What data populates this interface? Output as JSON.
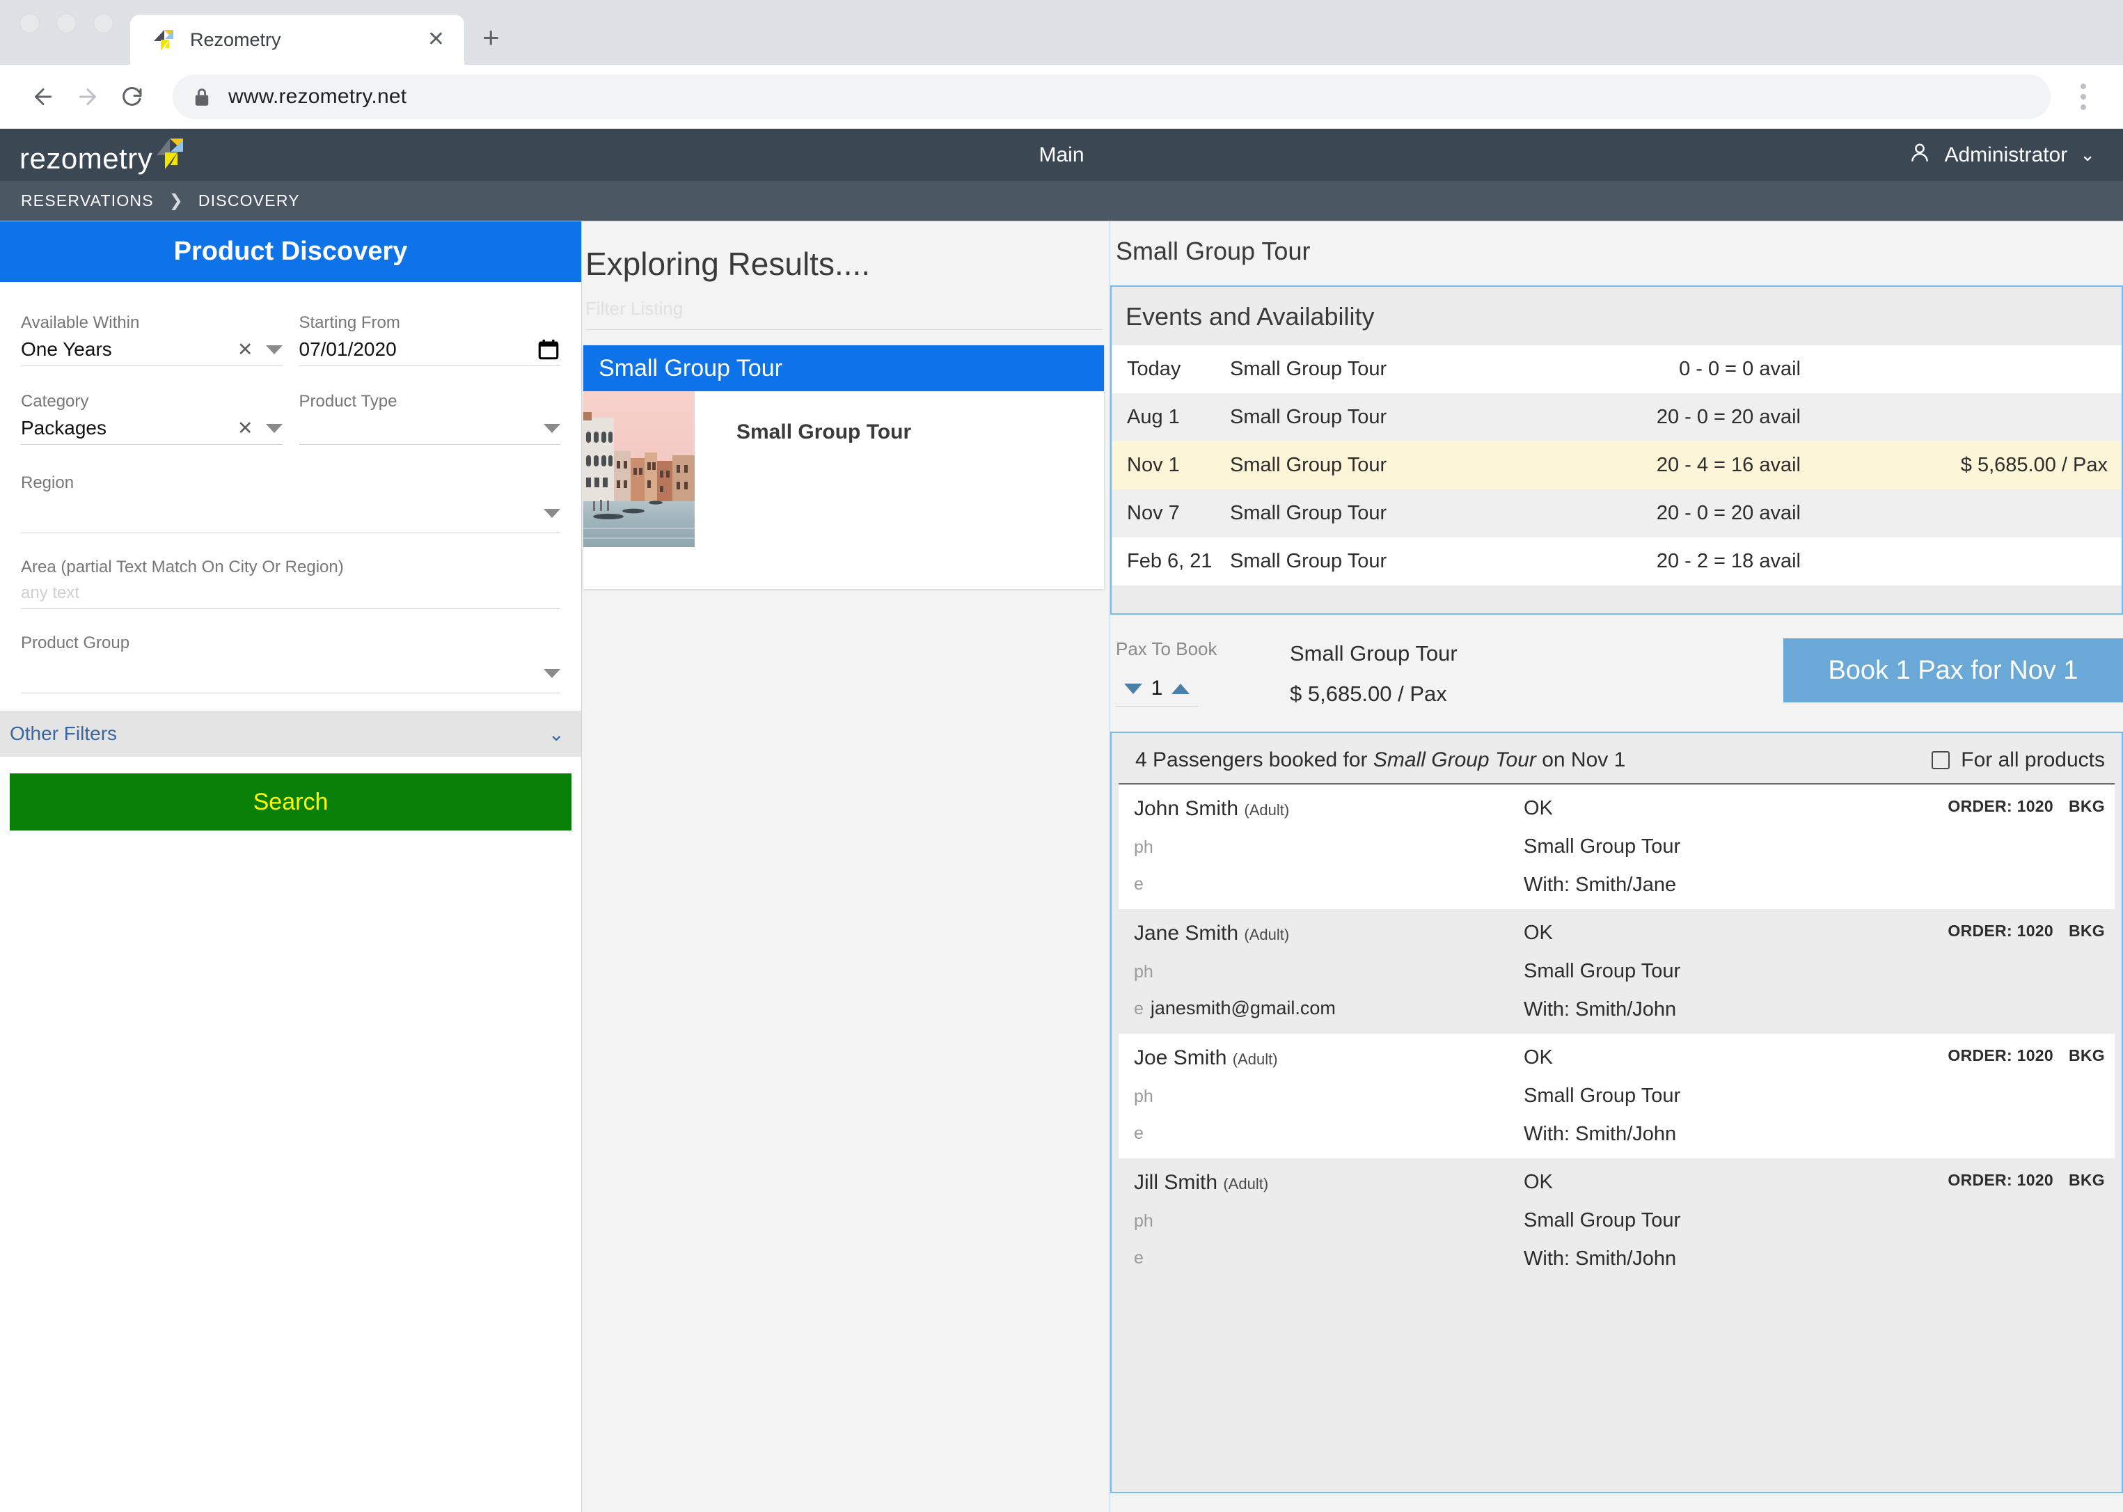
{
  "browser": {
    "tab_title": "Rezometry",
    "tab_close": "✕",
    "new_tab": "+",
    "url": "www.rezometry.net",
    "icons": {
      "back": "back-arrow-icon",
      "forward": "forward-arrow-icon",
      "reload": "reload-icon",
      "lock": "lock-icon",
      "menu": "kebab-menu-icon",
      "favicon": "rezometry-favicon"
    }
  },
  "appbar": {
    "brand": "rezometry",
    "main_label": "Main",
    "user": "Administrator",
    "chevron": "⌄"
  },
  "breadcrumb": {
    "items": [
      "RESERVATIONS",
      "DISCOVERY"
    ],
    "separator": "❯"
  },
  "discovery": {
    "title": "Product Discovery",
    "fields": {
      "available_within": {
        "label": "Available Within",
        "value": "One Years",
        "clear": "✕"
      },
      "starting_from": {
        "label": "Starting From",
        "value": "07/01/2020"
      },
      "category": {
        "label": "Category",
        "value": "Packages",
        "clear": "✕"
      },
      "product_type": {
        "label": "Product Type",
        "value": ""
      },
      "region": {
        "label": "Region",
        "value": ""
      },
      "area": {
        "label": "Area (partial Text Match On City Or Region)",
        "placeholder": "any text",
        "value": ""
      },
      "product_group": {
        "label": "Product Group",
        "value": ""
      }
    },
    "other_filters": {
      "label": "Other Filters",
      "chevron": "⌄"
    },
    "search_button": "Search"
  },
  "results": {
    "heading": "Exploring Results....",
    "filter_placeholder": "Filter Listing",
    "cards": [
      {
        "header": "Small Group Tour",
        "title": "Small Group Tour"
      }
    ]
  },
  "detail": {
    "title": "Small Group Tour",
    "events_panel_title": "Events and Availability",
    "events": [
      {
        "date": "Today",
        "name": "Small Group Tour",
        "avail": "0 - 0 = 0 avail",
        "price": "",
        "selected": false
      },
      {
        "date": "Aug 1",
        "name": "Small Group Tour",
        "avail": "20 - 0 = 20 avail",
        "price": "",
        "selected": false
      },
      {
        "date": "Nov 1",
        "name": "Small Group Tour",
        "avail": "20 - 4 = 16 avail",
        "price": "$ 5,685.00 / Pax",
        "selected": true
      },
      {
        "date": "Nov 7",
        "name": "Small Group Tour",
        "avail": "20 - 0 = 20 avail",
        "price": "",
        "selected": false
      },
      {
        "date": "Feb 6, 21",
        "name": "Small Group Tour",
        "avail": "20 - 2 = 18 avail",
        "price": "",
        "selected": false
      }
    ],
    "booking": {
      "pax_label": "Pax To Book",
      "pax_value": "1",
      "product_name": "Small Group Tour",
      "price": "$ 5,685.00 / Pax",
      "book_button": "Book 1 Pax for Nov 1"
    },
    "passengers_panel": {
      "heading_pre": "4 Passengers booked for ",
      "heading_em": "Small Group Tour",
      "heading_post": " on Nov 1",
      "for_all_products": "For all products",
      "rows": [
        {
          "name": "John Smith",
          "type": "(Adult)",
          "ph_label": "ph",
          "ph": "",
          "e_label": "e",
          "email": "",
          "status": "OK",
          "product": "Small Group Tour",
          "with": "With: Smith/Jane",
          "order": "ORDER: 1020",
          "bkg": "BKG"
        },
        {
          "name": "Jane Smith",
          "type": "(Adult)",
          "ph_label": "ph",
          "ph": "",
          "e_label": "e",
          "email": "janesmith@gmail.com",
          "status": "OK",
          "product": "Small Group Tour",
          "with": "With: Smith/John",
          "order": "ORDER: 1020",
          "bkg": "BKG"
        },
        {
          "name": "Joe Smith",
          "type": "(Adult)",
          "ph_label": "ph",
          "ph": "",
          "e_label": "e",
          "email": "",
          "status": "OK",
          "product": "Small Group Tour",
          "with": "With: Smith/John",
          "order": "ORDER: 1020",
          "bkg": "BKG"
        },
        {
          "name": "Jill Smith",
          "type": "(Adult)",
          "ph_label": "ph",
          "ph": "",
          "e_label": "e",
          "email": "",
          "status": "OK",
          "product": "Small Group Tour",
          "with": "With: Smith/John",
          "order": "ORDER: 1020",
          "bkg": "BKG"
        }
      ]
    }
  },
  "colors": {
    "app_bar": "#3b4752",
    "breadcrumb_bar": "#4b5864",
    "accent_blue": "#0e72e8",
    "search_green": "#087f07",
    "search_text_yellow": "#fffc00",
    "panel_border": "#78b9ef",
    "selected_row": "#fdf5d8",
    "book_button": "#6aa8d8"
  }
}
